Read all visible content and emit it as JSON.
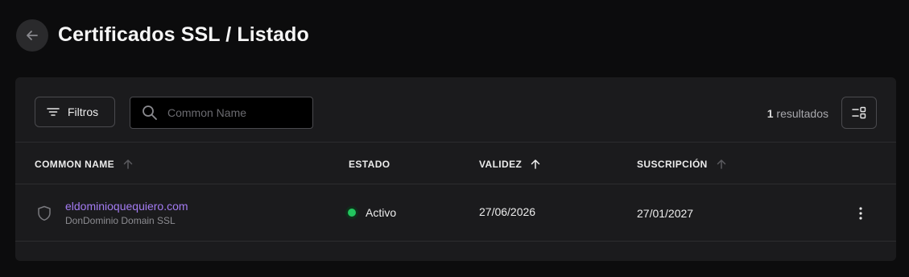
{
  "page": {
    "title": "Certificados SSL / Listado"
  },
  "toolbar": {
    "filter_label": "Filtros",
    "search_placeholder": "Common Name",
    "results_count": "1",
    "results_label": "resultados"
  },
  "table": {
    "columns": [
      {
        "label": "COMMON NAME",
        "sort": "inactive"
      },
      {
        "label": "ESTADO"
      },
      {
        "label": "VALIDEZ",
        "sort": "ascending"
      },
      {
        "label": "SUSCRIPCIÓN",
        "sort": "inactive"
      }
    ],
    "rows": [
      {
        "common_name": "eldominioquequiero.com",
        "product": "DonDominio Domain SSL",
        "status": "Activo",
        "status_color": "#22c55e",
        "validez": "27/06/2026",
        "suscripcion": "27/01/2027"
      }
    ]
  },
  "colors": {
    "accent": "#a37bf2",
    "background": "#0c0c0d",
    "card": "#1b1b1d"
  },
  "icons": [
    "arrow-left-icon",
    "filter-icon",
    "search-icon",
    "layout-toggle-icon",
    "sort-arrow-icon",
    "shield-icon",
    "status-dot-icon",
    "kebab-menu-icon"
  ]
}
